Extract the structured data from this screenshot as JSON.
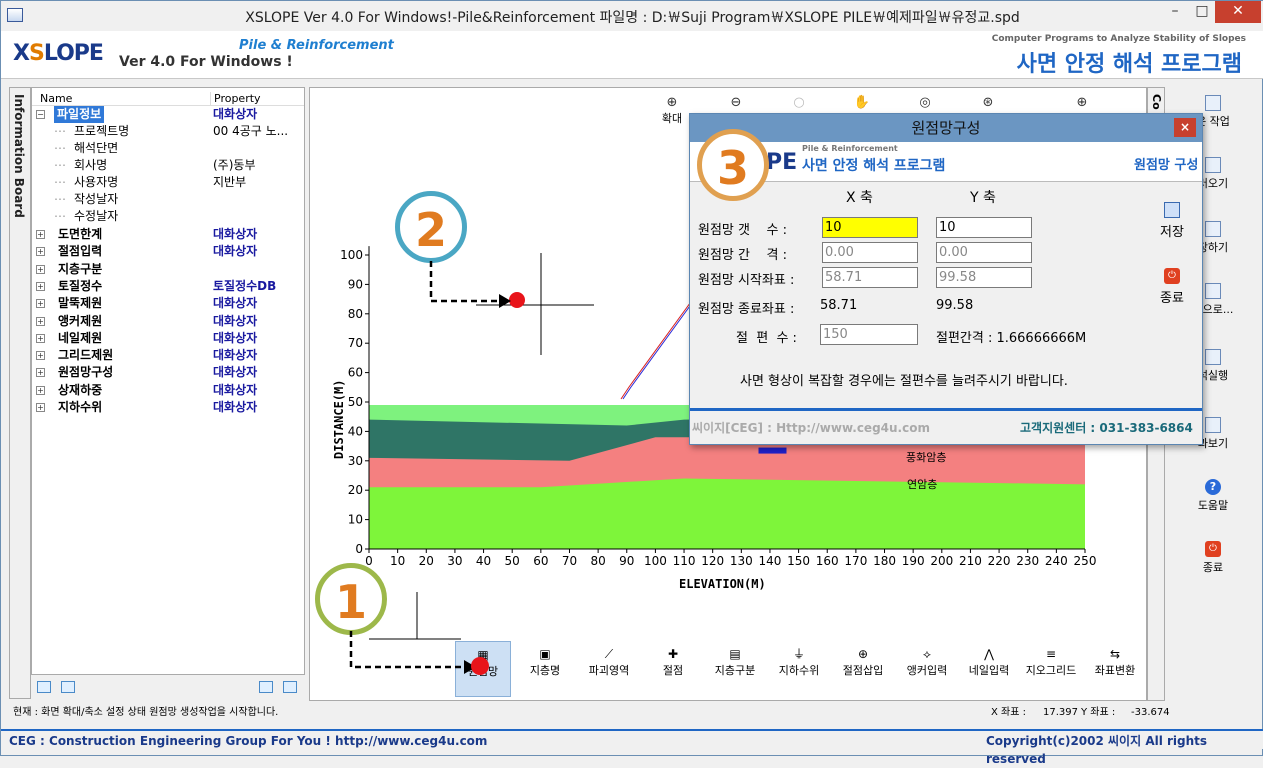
{
  "window": {
    "title": "XSLOPE Ver 4.0 For Windows!-Pile&Reinforcement  파일명 : D:￦Suji Program￦XSLOPE PILE￦예제파일￦유정교.spd",
    "min": "–",
    "max": "□",
    "close": "✕"
  },
  "banner": {
    "logo_x": "X",
    "logo_s": "S",
    "logo_rest": "LOPE",
    "version": "Ver 4.0 For Windows !",
    "subtitle": "Pile & Reinforcement",
    "right_small": "Computer Programs to Analyze Stability of Slopes",
    "right_big": "사면 안정 해석 프로그램"
  },
  "info_board": "Information Board",
  "tree": {
    "col_name": "Name",
    "col_property": "Property",
    "root": {
      "label": "파일정보",
      "value": "대화상자"
    },
    "file_children": [
      {
        "k": "프로젝트명",
        "v": "00 4공구 노..."
      },
      {
        "k": "해석단면",
        "v": ""
      },
      {
        "k": "회사명",
        "v": "(주)동부"
      },
      {
        "k": "사용자명",
        "v": "지반부"
      },
      {
        "k": "작성날자",
        "v": ""
      },
      {
        "k": "수정날자",
        "v": ""
      }
    ],
    "items": [
      {
        "k": "도면한계",
        "v": "대화상자"
      },
      {
        "k": "절점입력",
        "v": "대화상자"
      },
      {
        "k": "지층구분",
        "v": ""
      },
      {
        "k": "토질정수",
        "v": "토질정수DB"
      },
      {
        "k": "말뚝제원",
        "v": "대화상자"
      },
      {
        "k": "앵커제원",
        "v": "대화상자"
      },
      {
        "k": "네일제원",
        "v": "대화상자"
      },
      {
        "k": "그리드제원",
        "v": "대화상자"
      },
      {
        "k": "원점망구성",
        "v": "대화상자"
      },
      {
        "k": "상재하중",
        "v": "대화상자"
      },
      {
        "k": "지하수위",
        "v": "대화상자"
      }
    ]
  },
  "zoom_toolbar": {
    "zoom_label": "확대"
  },
  "chart": {
    "ylabel": "DISTANCE(M)",
    "xlabel": "ELEVATION(M)",
    "xticks": [
      "0",
      "10",
      "20",
      "30",
      "40",
      "50",
      "60",
      "70",
      "80",
      "90",
      "100",
      "110",
      "120",
      "130",
      "140",
      "150",
      "160",
      "170",
      "180",
      "190",
      "200",
      "210",
      "220",
      "230",
      "240",
      "250"
    ],
    "yticks": [
      "100",
      "90",
      "80",
      "70",
      "60",
      "50",
      "40",
      "30",
      "20",
      "10",
      "0"
    ],
    "layer_weathered": "풍화암층",
    "layer_soft": "연암층"
  },
  "annotations": {
    "n1": "1",
    "n2": "2",
    "n3": "3"
  },
  "bottom_toolbar": [
    "원점망",
    "지층명",
    "파괴영역",
    "절점",
    "지층구분",
    "지하수위",
    "절점삽입",
    "앵커입력",
    "네일입력",
    "지오그리드",
    "좌표변환"
  ],
  "right_panel": [
    "운 작업",
    "러오기",
    "장하기",
    "름으로...",
    "석실행",
    "과보기",
    "도움말",
    "종료"
  ],
  "right_panel_cut": "Co",
  "dialog": {
    "title": "원점망구성",
    "close": "×",
    "banner_small": "Pile & Reinforcement",
    "banner_logo_tail": "PE",
    "banner_main": "사면 안정 해석 프로그램",
    "banner_right": "원점망 구성",
    "x_axis": "X 축",
    "y_axis": "Y 축",
    "row_count_label": "원점망 갯    수 :",
    "row_count_x": "10",
    "row_count_y": "10",
    "row_gap_label": "원점망 간    격 :",
    "row_gap_x": "0.00",
    "row_gap_y": "0.00",
    "row_start_label": "원점망 시작좌표 :",
    "row_start_x": "58.71",
    "row_start_y": "99.58",
    "row_end_label": "원점망 종료좌표 :",
    "row_end_x": "58.71",
    "row_end_y": "99.58",
    "slices_label": "절  편  수 :",
    "slices_value": "150",
    "slice_gap": "절편간격 : 1.66666666M",
    "message": "사면 형상이 복잡할 경우에는 절편수를 늘려주시기 바랍니다.",
    "save": "저장",
    "exit": "종료",
    "footer_left": "씨이지[CEG] : Http://www.ceg4u.com",
    "footer_right": "고객지원센터 : 031-383-6864"
  },
  "status": {
    "message": "현재 : 화면 확대/축소 설정 상태  원점망 생성작업을 시작합니다.",
    "x_label": "X 좌표 :",
    "x_value": "17.397",
    "y_label": "Y 좌표 :",
    "y_value": "-33.674"
  },
  "footer": {
    "left": "CEG : Construction Engineering Group For You ! http://www.ceg4u.com",
    "right": "Copyright(c)2002 씨이지 All rights reserved"
  },
  "colors": {
    "layer_top": "#7ef27e",
    "layer_teal": "#2f7566",
    "layer_red": "#f48080",
    "layer_green": "#7ef53a",
    "accent_blue": "#1f66c4",
    "callout_ring_1": "#9db84a",
    "callout_ring_2": "#4aa7c4",
    "callout_ring_3": "#e0a050"
  }
}
